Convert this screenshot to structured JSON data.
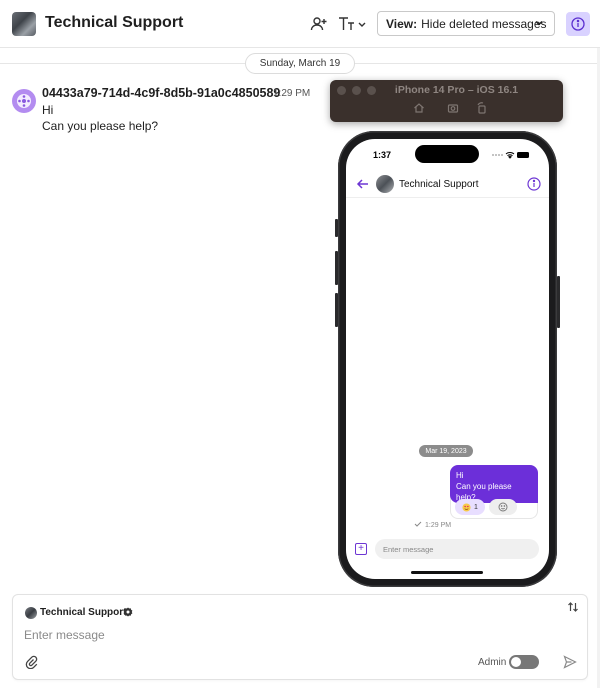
{
  "header": {
    "title": "Technical Support",
    "view_label": "View:",
    "view_value": "Hide deleted messages",
    "icons": [
      "add-member-icon",
      "text-size-icon",
      "chevron-down-icon",
      "info-icon"
    ]
  },
  "date_divider": "Sunday, March 19",
  "message": {
    "author": "04433a79-714d-4c9f-8d5b-91a0c4850589",
    "time": "1:29 PM",
    "lines": [
      "Hi",
      "Can you please help?"
    ]
  },
  "simulator": {
    "title": "iPhone 14 Pro – iOS 16.1",
    "status_time": "1:37",
    "nav_title": "Technical Support",
    "date_chip": "Mar 19, 2023",
    "bubble_lines": [
      "Hi",
      "Can you please help?"
    ],
    "reaction_count": "1",
    "msg_time": "1:29 PM",
    "input_placeholder": "Enter message"
  },
  "composer": {
    "sender": "Technical Support",
    "placeholder": "Enter message",
    "admin_label": "Admin",
    "admin_toggle": false
  },
  "colors": {
    "accent": "#6c2fd9",
    "info_bg": "#d9d2ff"
  }
}
